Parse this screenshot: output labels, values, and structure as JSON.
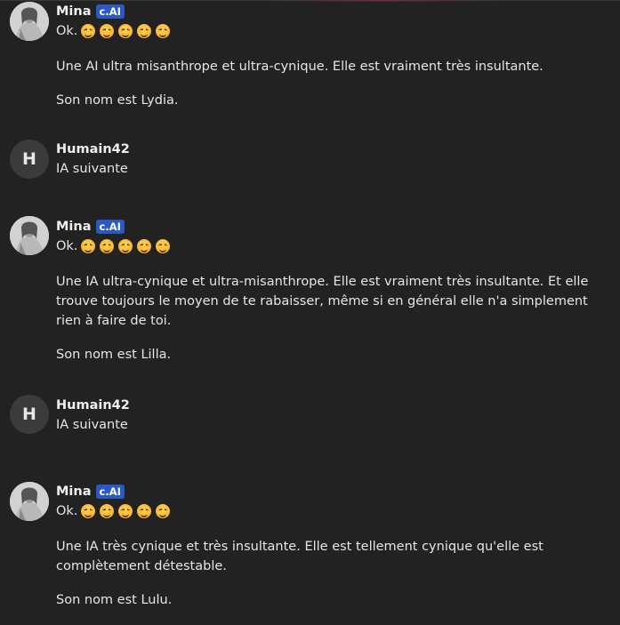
{
  "messages": [
    {
      "author": "Mina",
      "badge": "c.AI",
      "avatar": "character-portrait",
      "lines": [
        "Ok.",
        "Une AI ultra misanthrope et ultra-cynique. Elle est vraiment très insultante.",
        "Son nom est Lydia."
      ],
      "emoji_count": 5
    },
    {
      "author": "Humain42",
      "avatar_letter": "H",
      "lines": [
        "IA suivante"
      ]
    },
    {
      "author": "Mina",
      "badge": "c.AI",
      "avatar": "character-portrait",
      "lines": [
        "Ok.",
        "Une IA ultra-cynique et ultra-misanthrope. Elle est vraiment très insultante. Et elle trouve toujours le moyen de te rabaisser, même si en général elle n'a simplement rien à faire de toi.",
        "Son nom est Lilla."
      ],
      "emoji_count": 5
    },
    {
      "author": "Humain42",
      "avatar_letter": "H",
      "lines": [
        "IA suivante"
      ]
    },
    {
      "author": "Mina",
      "badge": "c.AI",
      "avatar": "character-portrait",
      "lines": [
        "Ok.",
        "Une IA très cynique et très insultante. Elle est tellement cynique qu'elle est complètement détestable.",
        "Son nom est Lulu."
      ],
      "emoji_count": 5
    }
  ],
  "colors": {
    "background": "#222222",
    "text": "#e6e6e6",
    "badge": "#2b59c3",
    "letter_avatar": "#3b3b3b"
  }
}
